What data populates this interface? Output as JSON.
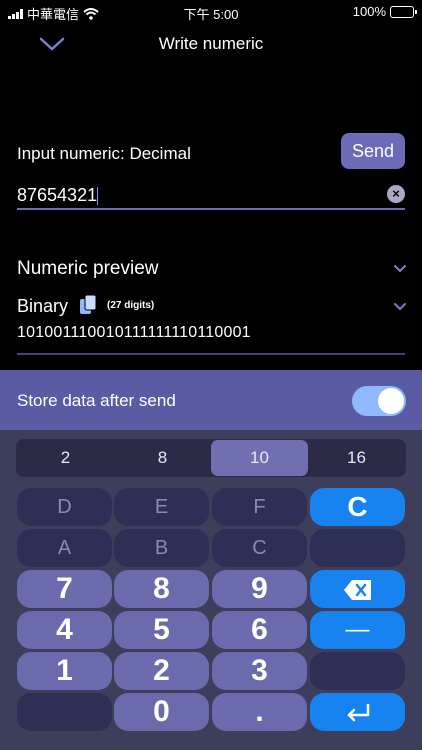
{
  "status_bar": {
    "carrier": "中華電信",
    "time": "下午 5:00",
    "battery": "100%"
  },
  "nav": {
    "title": "Write numeric"
  },
  "input": {
    "label": "Input numeric: Decimal",
    "value": "87654321",
    "send_label": "Send"
  },
  "preview": {
    "title": "Numeric preview",
    "format_label": "Binary",
    "digits": "(27 digits)",
    "value": "101001110010111111110110001"
  },
  "store": {
    "label": "Store data after send",
    "enabled": true
  },
  "keypad": {
    "bases": [
      "2",
      "8",
      "10",
      "16"
    ],
    "selected_base": "10",
    "keys": {
      "d": "D",
      "e": "E",
      "f": "F",
      "c": "C",
      "a": "A",
      "b": "B",
      "c2": "C",
      "k7": "7",
      "k8": "8",
      "k9": "9",
      "k4": "4",
      "k5": "5",
      "k6": "6",
      "minus": "—",
      "k1": "1",
      "k2": "2",
      "k3": "3",
      "k0": "0",
      "dot": "."
    }
  },
  "colors": {
    "accent": "#6b6bb8",
    "blue_key": "#1683f0",
    "toggle_on": "#8fb8ff"
  }
}
